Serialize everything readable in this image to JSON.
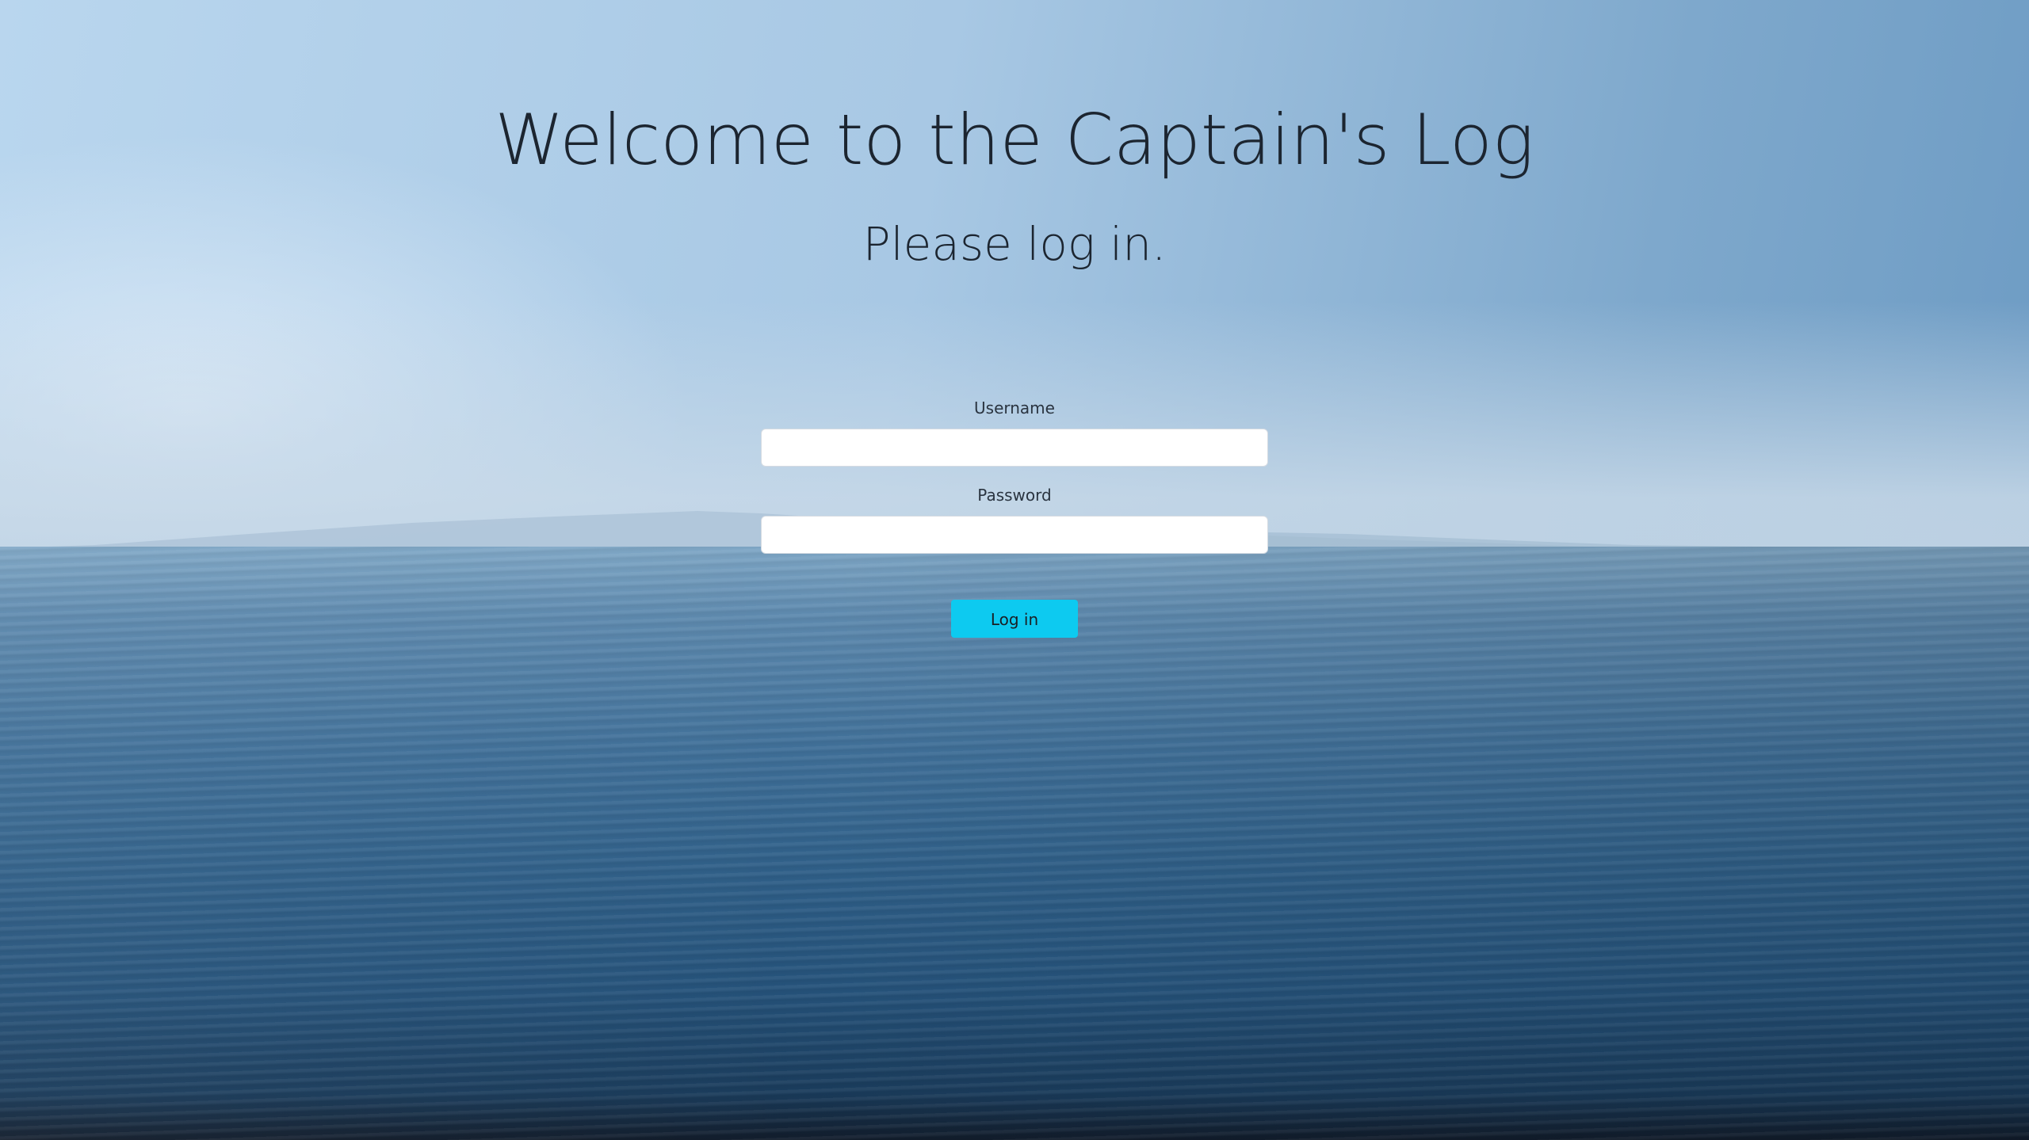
{
  "header": {
    "title": "Welcome to the Captain's Log",
    "subtitle": "Please log in."
  },
  "form": {
    "username_label": "Username",
    "username_value": "",
    "password_label": "Password",
    "password_value": "",
    "submit_label": "Log in"
  },
  "colors": {
    "button_background": "#0dcaf0",
    "text": "#1c2530",
    "input_background": "#ffffff"
  }
}
